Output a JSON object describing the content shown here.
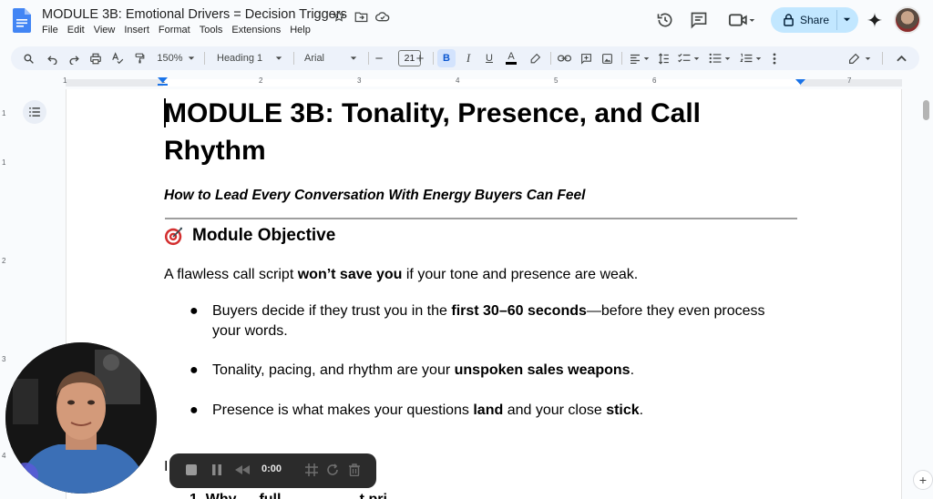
{
  "document": {
    "title": "MODULE 3B: Emotional Drivers = Decision Triggers",
    "menu": [
      "File",
      "Edit",
      "View",
      "Insert",
      "Format",
      "Tools",
      "Extensions",
      "Help"
    ]
  },
  "header": {
    "share_label": "Share"
  },
  "toolbar": {
    "zoom": "150%",
    "style": "Heading 1",
    "font": "Arial",
    "font_size": "21",
    "bold_label": "B",
    "italic_label": "I",
    "underline_label": "U",
    "color_label": "A"
  },
  "ruler": {
    "top_numbers": [
      "1",
      "1",
      "2",
      "3",
      "4",
      "5",
      "6",
      "7"
    ],
    "left_numbers": [
      "1",
      "1",
      "2",
      "3",
      "4"
    ]
  },
  "content": {
    "heading": "MODULE 3B: Tonality, Presence, and Call Rhythm",
    "subtitle": "How to Lead Every Conversation With Energy Buyers Can Feel",
    "section_title": "Module Objective",
    "intro_pre": "A flawless call script ",
    "intro_bold": "won’t save you",
    "intro_post": " if your tone and presence are weak.",
    "bullets": [
      {
        "pre": "Buyers decide if they trust you in the ",
        "bold": "first 30–60 seconds",
        "post": "—before they even process your words."
      },
      {
        "pre": "Tonality, pacing, and rhythm are your ",
        "bold": "unspoken sales weapons",
        "post": "."
      },
      {
        "pre": "Presence is what makes your questions ",
        "bold": "land",
        "mid": " and your close ",
        "bold2": "stick",
        "post": "."
      }
    ],
    "partial_line": "I",
    "next_item": "1.   Why … full … … … … t pri … "
  },
  "recorder": {
    "timer": "0:00"
  }
}
